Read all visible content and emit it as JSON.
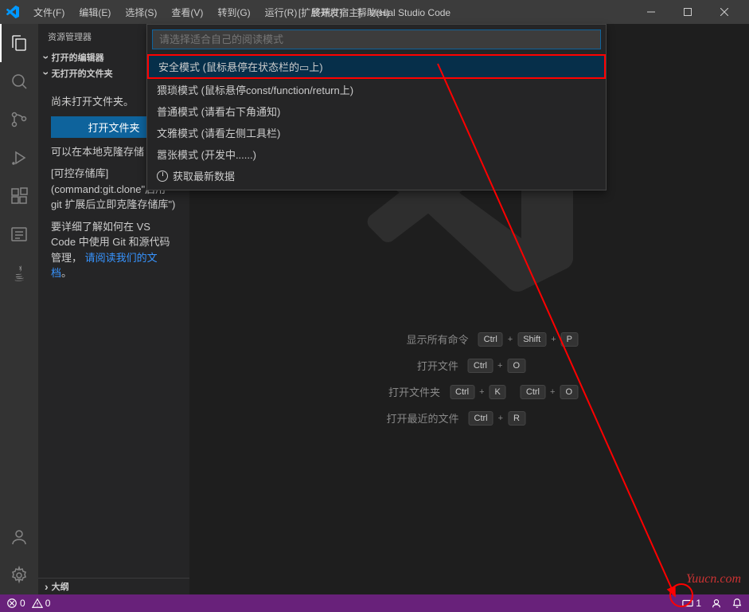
{
  "titlebar": {
    "title": "[扩展开发宿主] - Visual Studio Code",
    "menus": [
      "文件(F)",
      "编辑(E)",
      "选择(S)",
      "查看(V)",
      "转到(G)",
      "运行(R)",
      "终端(T)",
      "帮助(H)"
    ]
  },
  "sidebar": {
    "title": "资源管理器",
    "opened_editors": "打开的编辑器",
    "no_folder": "无打开的文件夹",
    "no_folder_text": "尚未打开文件夹。",
    "open_folder_btn": "打开文件夹",
    "clone_text": "可以在本地克隆存储",
    "repo_hint": "[可控存储库]",
    "repo_command": "(command:git.clone\"启用 git 扩展后立即克隆存储库\")",
    "learn_text": "要详细了解如何在 VS Code 中使用 Git 和源代码管理，",
    "read_docs": "请阅读我们的文档",
    "outline": "大纲"
  },
  "dropdown": {
    "placeholder": "请选择适合自己的阅读模式",
    "items": [
      "安全模式 (鼠标悬停在状态栏的▭上)",
      "猥琐模式 (鼠标悬停const/function/return上)",
      "普通模式 (请看右下角通知)",
      "文雅模式 (请看左侧工具栏)",
      "嚣张模式 (开发中......)",
      "获取最新数据"
    ]
  },
  "shortcuts": {
    "rows": [
      {
        "label": "显示所有命令",
        "keys": [
          "Ctrl",
          "Shift",
          "P"
        ]
      },
      {
        "label": "打开文件",
        "keys": [
          "Ctrl",
          "O"
        ]
      },
      {
        "label": "打开文件夹",
        "keys": [
          "Ctrl",
          "K",
          "Ctrl",
          "O"
        ]
      },
      {
        "label": "打开最近的文件",
        "keys": [
          "Ctrl",
          "R"
        ]
      }
    ]
  },
  "statusbar": {
    "errors": "0",
    "warnings": "0",
    "right_badge": "1"
  },
  "watermark": "Yuucn.com"
}
